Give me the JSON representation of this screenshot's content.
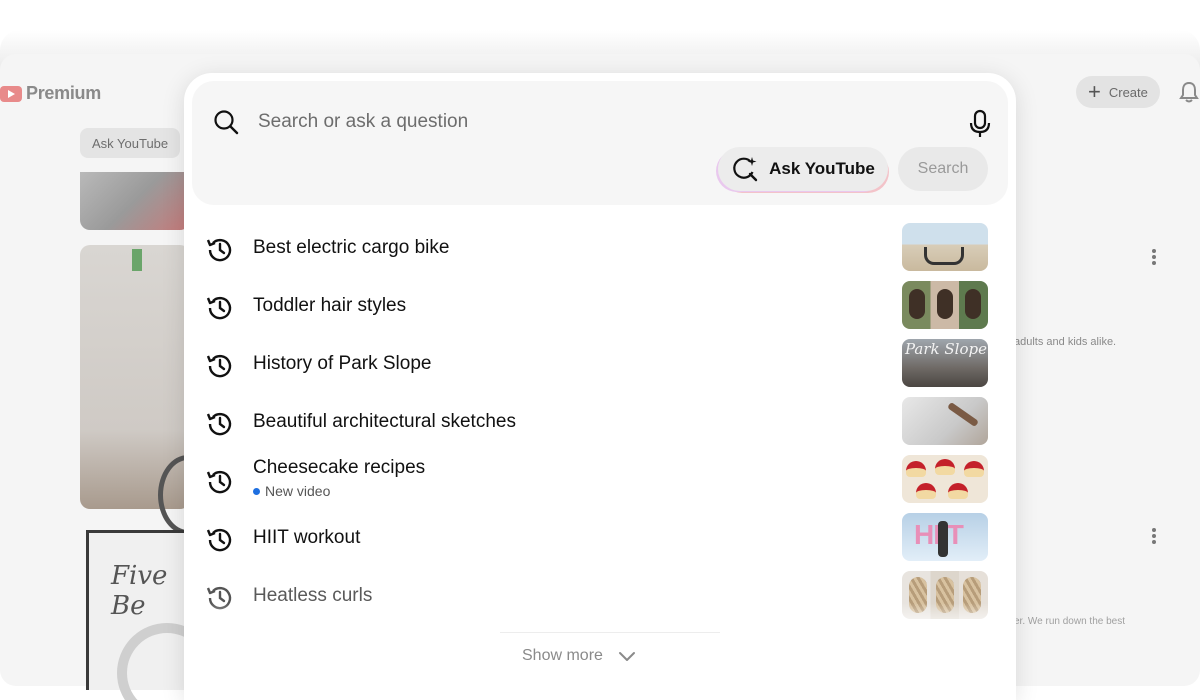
{
  "background": {
    "logo_text": "Premium",
    "ask_chip": "Ask YouTube",
    "create_label": "Create",
    "thumb_text": "Five Be",
    "side_text_1": "adults and kids alike.",
    "side_text_2": "er. We run down the best"
  },
  "search": {
    "placeholder": "Search or ask a question",
    "ask_label": "Ask YouTube",
    "search_label": "Search"
  },
  "history": [
    {
      "label": "Best electric cargo bike",
      "thumb": "cargo-bike"
    },
    {
      "label": "Toddler hair styles",
      "thumb": "toddler-hair"
    },
    {
      "label": "History of Park Slope",
      "thumb": "park-slope",
      "thumb_text": "Park Slope"
    },
    {
      "label": "Beautiful architectural sketches",
      "thumb": "sketches"
    },
    {
      "label": "Cheesecake recipes",
      "sub": "New video",
      "thumb": "cheesecake"
    },
    {
      "label": "HIIT workout",
      "thumb": "hiit",
      "thumb_text": "HIIT"
    },
    {
      "label": "Heatless curls",
      "thumb": "curls"
    }
  ],
  "show_more_label": "Show more",
  "colors": {
    "accent_dot": "#1e6fe0",
    "panel_bg": "#ffffff",
    "searchbox_bg": "#f6f6f6"
  },
  "icons": {
    "search": "search-icon",
    "mic": "mic-icon",
    "ask": "ask-sparkle-icon",
    "history": "history-icon",
    "chevron": "chevron-down-icon"
  }
}
